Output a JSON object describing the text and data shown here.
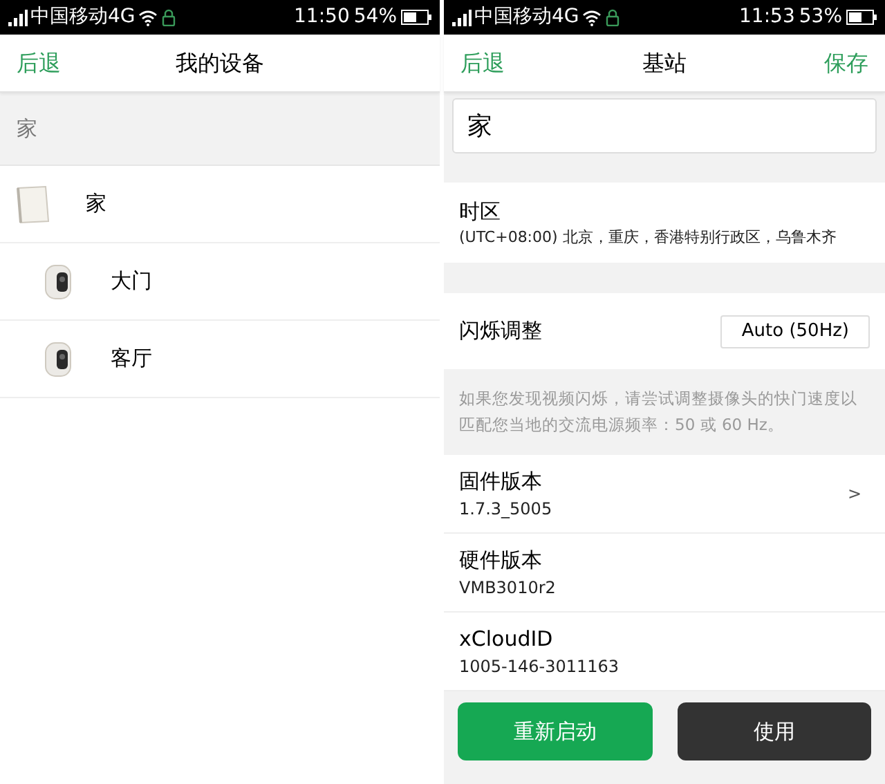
{
  "screens": [
    {
      "status_bar": {
        "carrier": "中国移动4G",
        "time": "11:50",
        "battery": "54%"
      },
      "header": {
        "back": "后退",
        "title": "我的设备"
      },
      "section": "家",
      "devices": [
        {
          "name": "家",
          "kind": "base",
          "indented": false
        },
        {
          "name": "大门",
          "kind": "camera",
          "indented": true
        },
        {
          "name": "客厅",
          "kind": "camera",
          "indented": true
        }
      ]
    },
    {
      "status_bar": {
        "carrier": "中国移动4G",
        "time": "11:53",
        "battery": "53%"
      },
      "header": {
        "back": "后退",
        "title": "基站",
        "action": "保存"
      },
      "name_field": {
        "value": "家"
      },
      "timezone": {
        "label": "时区",
        "value": "(UTC+08:00) 北京，重庆，香港特别行政区，乌鲁木齐"
      },
      "flicker": {
        "label": "闪烁调整",
        "value": "Auto (50Hz)",
        "hint": "如果您发现视频闪烁，请尝试调整摄像头的快门速度以匹配您当地的交流电源频率：50 或 60 Hz。"
      },
      "info_rows": [
        {
          "label": "固件版本",
          "value": "1.7.3_5005",
          "chevron": ">"
        },
        {
          "label": "硬件版本",
          "value": "VMB3010r2"
        },
        {
          "label": "xCloudID",
          "value": "1005-146-3011163"
        }
      ],
      "buttons": [
        {
          "label": "重新启动",
          "kind": "primary"
        },
        {
          "label": "使用",
          "kind": "dark"
        }
      ]
    }
  ]
}
